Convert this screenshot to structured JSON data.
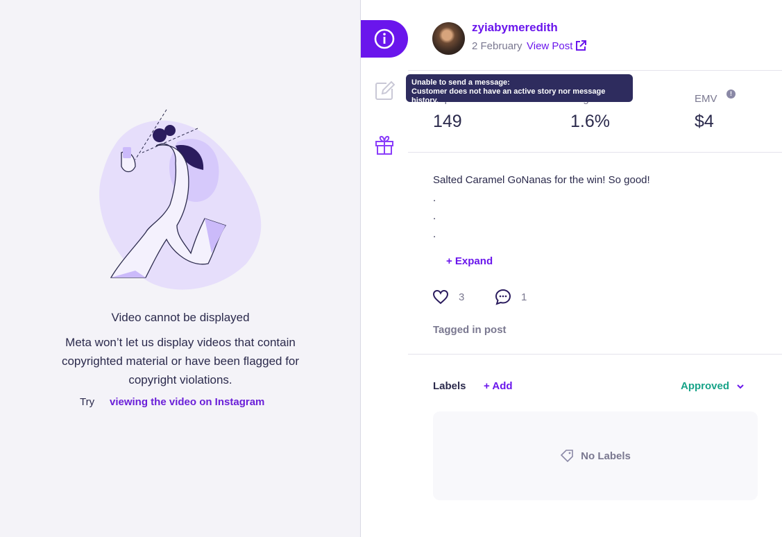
{
  "media": {
    "title": "Video cannot be displayed",
    "message": "Meta won’t let us display videos that contain copyrighted material or have been flagged for copyright violations.",
    "try_label": "Try",
    "link_label": "viewing the video on Instagram"
  },
  "rail": {
    "tabs": [
      {
        "name": "info",
        "icon": "info-icon",
        "active": true
      },
      {
        "name": "edit",
        "icon": "edit-icon",
        "active": false
      },
      {
        "name": "gift",
        "icon": "gift-icon",
        "active": false
      }
    ]
  },
  "post": {
    "username": "zyiabymeredith",
    "date": "2 February",
    "view_post_label": "View Post"
  },
  "tooltip": {
    "line1": "Unable to send a message:",
    "line2": "Customer does not have an active story nor message history."
  },
  "stats": [
    {
      "label": "Impressions",
      "value": "149"
    },
    {
      "label": "Eng. Rate",
      "value": "1.6%"
    },
    {
      "label": "EMV",
      "value": "$4"
    }
  ],
  "caption": {
    "lines": [
      "Salted Caramel GoNanas for the win! So good!",
      ".",
      ".",
      "."
    ],
    "expand_label": "+ Expand"
  },
  "reactions": {
    "likes": "3",
    "comments": "1"
  },
  "tagged_label": "Tagged in post",
  "labels": {
    "title": "Labels",
    "add_label": "+ Add",
    "status": "Approved",
    "empty_text": "No Labels"
  },
  "colors": {
    "accent": "#6a16ec",
    "approved": "#17a388",
    "tooltip_bg": "#2e2c5e"
  }
}
